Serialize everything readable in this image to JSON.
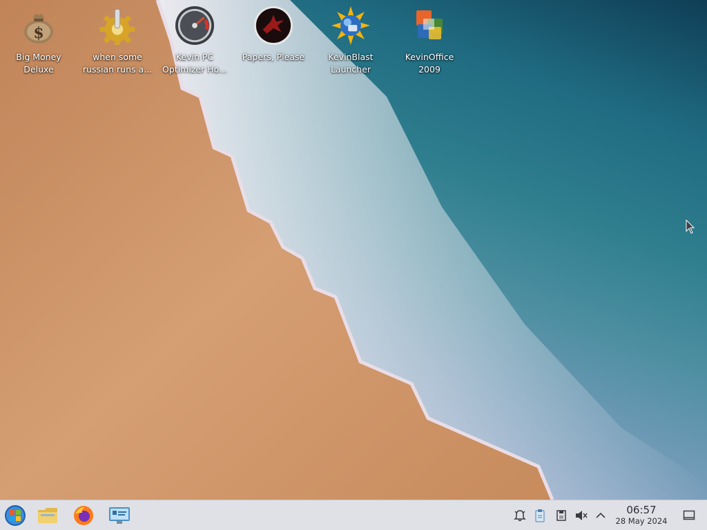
{
  "desktop": {
    "icons": [
      {
        "label": "Big Money\nDeluxe",
        "icon": "money-bag-icon"
      },
      {
        "label": "when some\nrussian runs a...",
        "icon": "gear-icon"
      },
      {
        "label": "Kevin PC\nOptimizer Ho...",
        "icon": "speedometer-icon"
      },
      {
        "label": "Papers, Please",
        "icon": "eagle-emblem-icon"
      },
      {
        "label": "KevinBlast\nLauncher",
        "icon": "sun-globe-icon"
      },
      {
        "label": "KevinOffice\n2009",
        "icon": "office-logo-icon"
      }
    ]
  },
  "taskbar": {
    "launchers": [
      "start-orb-icon",
      "file-manager-icon",
      "firefox-icon",
      "system-settings-icon"
    ],
    "tray": [
      "notifications-icon",
      "clipboard-icon",
      "disk-icon",
      "volume-muted-icon",
      "expand-tray-icon"
    ],
    "clock": {
      "time": "06:57",
      "date": "28 May 2024"
    },
    "show_desktop": "show-desktop-icon"
  },
  "colors": {
    "sand": "#d39a6e",
    "sea": "#2f7f8f",
    "foam": "#f4eef5",
    "taskbar": "#dfe1e6"
  }
}
